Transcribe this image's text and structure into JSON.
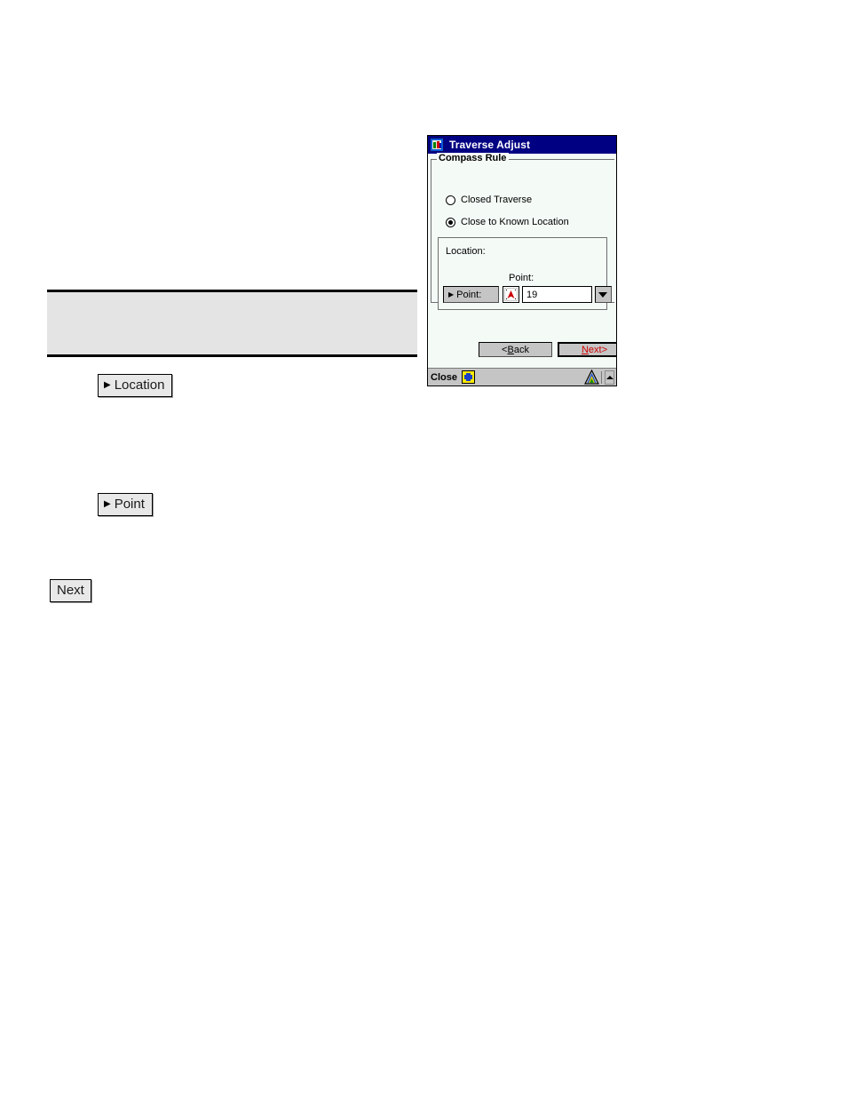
{
  "document": {
    "callout_buttons": [
      {
        "id": "location",
        "icon": "triangle-right-icon",
        "label": "Location"
      },
      {
        "id": "point",
        "icon": "triangle-right-icon",
        "label": "Point"
      },
      {
        "id": "next",
        "icon": "",
        "label": "Next"
      }
    ]
  },
  "pda": {
    "titlebar": {
      "icon": "app-window-icon",
      "title": "Traverse Adjust"
    },
    "groupbox": {
      "legend": "Compass Rule",
      "options": [
        {
          "label": "Closed Traverse",
          "selected": false
        },
        {
          "label": "Close to Known Location",
          "selected": true
        }
      ]
    },
    "location_panel": {
      "label": "Location:",
      "point_caption": "Point:",
      "point_button_label": "Point:",
      "point_button_icon": "triangle-right-icon",
      "pick_icon": "map-point-pick-icon",
      "point_value": "19",
      "dropdown_icon": "chevron-down-icon"
    },
    "nav": {
      "back_prefix": "< ",
      "back_accel": "B",
      "back_rest": "ack",
      "next_accel": "N",
      "next_rest": "ext",
      "next_suffix": " >"
    },
    "taskbar": {
      "close_label": "Close",
      "start_icon": "yellow-start-icon",
      "tray_icon": "survey-app-tray-icon",
      "expand_icon": "chevron-up-icon"
    },
    "colors": {
      "titlebar_bg": "#000082",
      "client_bg": "#f4faf6",
      "button_face": "#c5c5c5",
      "next_text": "#d00000"
    }
  }
}
